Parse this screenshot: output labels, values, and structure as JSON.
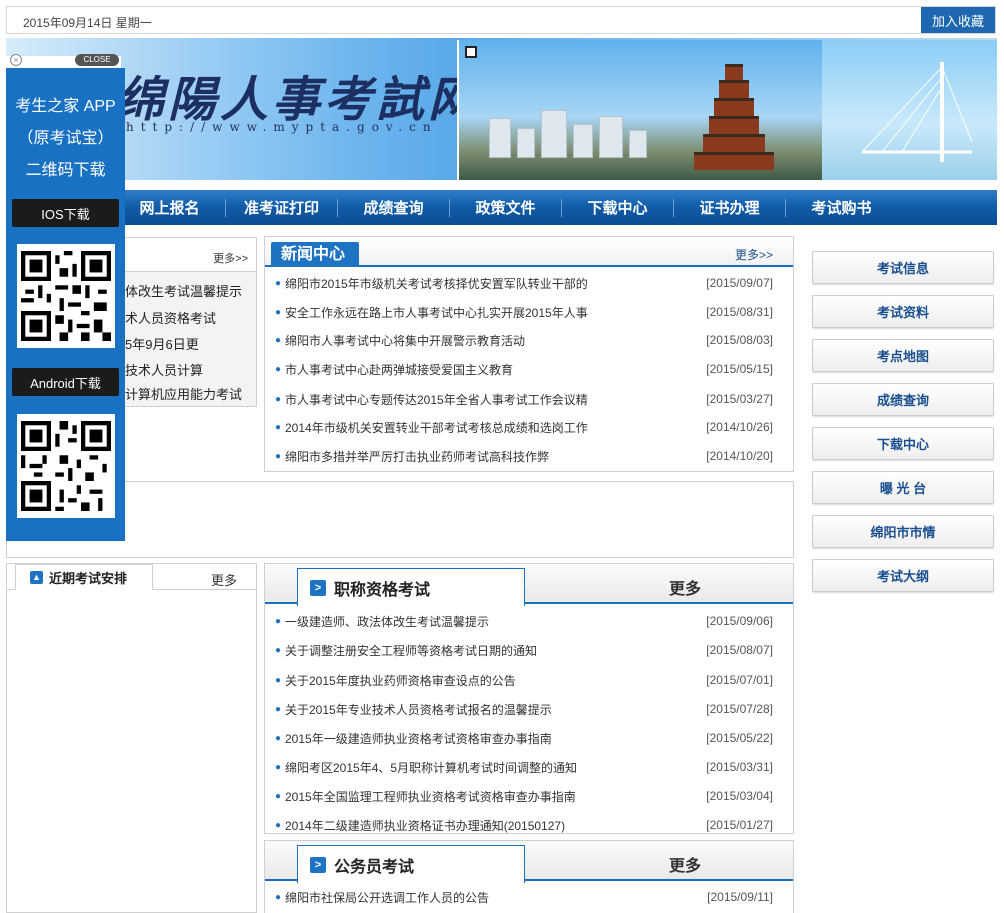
{
  "topbar": {
    "date": "2015年09月14日  星期一",
    "favorite": "加入收藏"
  },
  "banner": {
    "title": "绵陽人事考試网",
    "url": "http://www.mypta.gov.cn"
  },
  "nav": {
    "items": [
      "网上报名",
      "准考证打印",
      "成绩查询",
      "政策文件",
      "下载中心",
      "证书办理",
      "考试购书"
    ]
  },
  "notice": {
    "more": "更多>>",
    "items": [
      "体改生考试温馨提示",
      "术人员资格考试",
      "5年9月6日更",
      "技术人员计算",
      "计算机应用能力考试"
    ]
  },
  "news": {
    "tab": "新闻中心",
    "more": "更多>>",
    "items": [
      {
        "title": "绵阳市2015年市级机关考试考核择优安置军队转业干部的",
        "date": "[2015/09/07]"
      },
      {
        "title": "安全工作永远在路上市人事考试中心扎实开展2015年人事",
        "date": "[2015/08/31]"
      },
      {
        "title": "绵阳市人事考试中心将集中开展警示教育活动",
        "date": "[2015/08/03]"
      },
      {
        "title": "市人事考试中心赴两弹城接受爱国主义教育",
        "date": "[2015/05/15]"
      },
      {
        "title": "市人事考试中心专题传达2015年全省人事考试工作会议精",
        "date": "[2015/03/27]"
      },
      {
        "title": "2014年市级机关安置转业干部考试考核总成绩和选岗工作",
        "date": "[2014/10/26]"
      },
      {
        "title": "绵阳市多措并举严厉打击执业药师考试高科技作弊",
        "date": "[2014/10/20]"
      }
    ]
  },
  "sidebar_right": {
    "items": [
      "考试信息",
      "考试资料",
      "考点地图",
      "成绩查询",
      "下载中心",
      "曝 光 台",
      "绵阳市市情",
      "考试大纲"
    ]
  },
  "recent": {
    "tab": "近期考试安排",
    "more": "更多"
  },
  "title_exam": {
    "tab": "职称资格考试",
    "more": "更多",
    "items": [
      {
        "title": "一级建造师、政法体改生考试温馨提示",
        "date": "[2015/09/06]"
      },
      {
        "title": "关于调整注册安全工程师等资格考试日期的通知",
        "date": "[2015/08/07]"
      },
      {
        "title": "关于2015年度执业药师资格审查设点的公告",
        "date": "[2015/07/01]"
      },
      {
        "title": "关于2015年专业技术人员资格考试报名的温馨提示",
        "date": "[2015/07/28]"
      },
      {
        "title": "2015年一级建造师执业资格考试资格审查办事指南",
        "date": "[2015/05/22]"
      },
      {
        "title": "绵阳考区2015年4、5月职称计算机考试时间调整的通知",
        "date": "[2015/03/31]"
      },
      {
        "title": "2015年全国监理工程师执业资格考试资格审查办事指南",
        "date": "[2015/03/04]"
      },
      {
        "title": "2014年二级建造师执业资格证书办理通知(20150127)",
        "date": "[2015/01/27]"
      }
    ]
  },
  "civil_exam": {
    "tab": "公务员考试",
    "more": "更多",
    "items": [
      {
        "title": "绵阳市社保局公开选调工作人员的公告",
        "date": "[2015/09/11]"
      }
    ]
  },
  "float_ad": {
    "line1": "考生之家 APP",
    "line2": "（原考试宝）",
    "line3": "二维码下载",
    "ios": "IOS下载",
    "android": "Android下载",
    "close": "CLOSE"
  }
}
